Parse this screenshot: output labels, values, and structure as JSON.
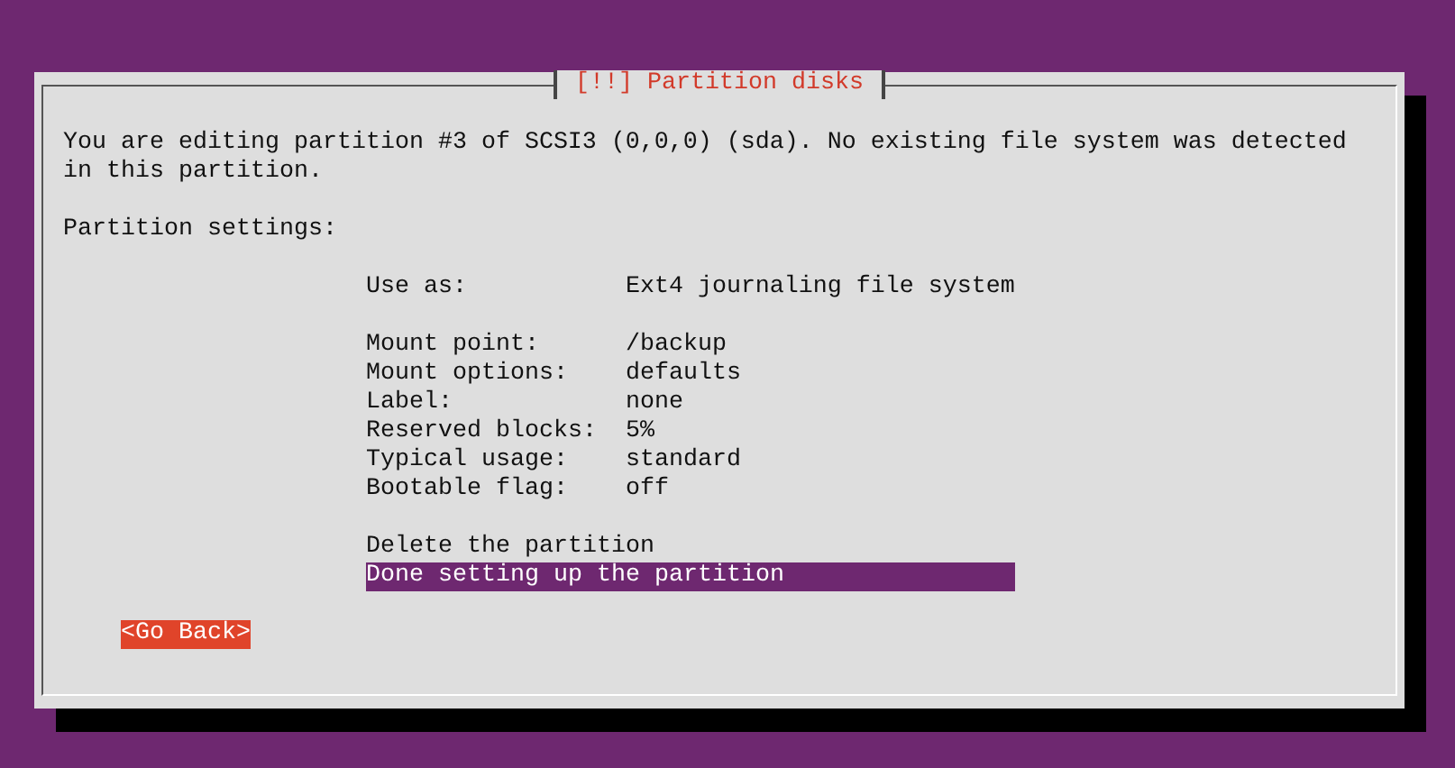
{
  "dialog": {
    "title": "[!!] Partition disks",
    "message": "You are editing partition #3 of SCSI3 (0,0,0) (sda). No existing file system was detected in this partition.",
    "section_label": "Partition settings:",
    "setting_groups": [
      {
        "settings": [
          {
            "label": "Use as:",
            "value": "Ext4 journaling file system",
            "selected": false
          }
        ]
      },
      {
        "settings": [
          {
            "label": "Mount point:",
            "value": "/backup",
            "selected": false
          },
          {
            "label": "Mount options:",
            "value": "defaults",
            "selected": false
          },
          {
            "label": "Label:",
            "value": "none",
            "selected": false
          },
          {
            "label": "Reserved blocks:",
            "value": "5%",
            "selected": false
          },
          {
            "label": "Typical usage:",
            "value": "standard",
            "selected": false
          },
          {
            "label": "Bootable flag:",
            "value": "off",
            "selected": false
          }
        ]
      }
    ],
    "actions": [
      {
        "label": "Delete the partition",
        "selected": false
      },
      {
        "label": "Done setting up the partition",
        "selected": true
      }
    ],
    "back_button": {
      "label": "<Go Back>",
      "focused": true
    }
  }
}
